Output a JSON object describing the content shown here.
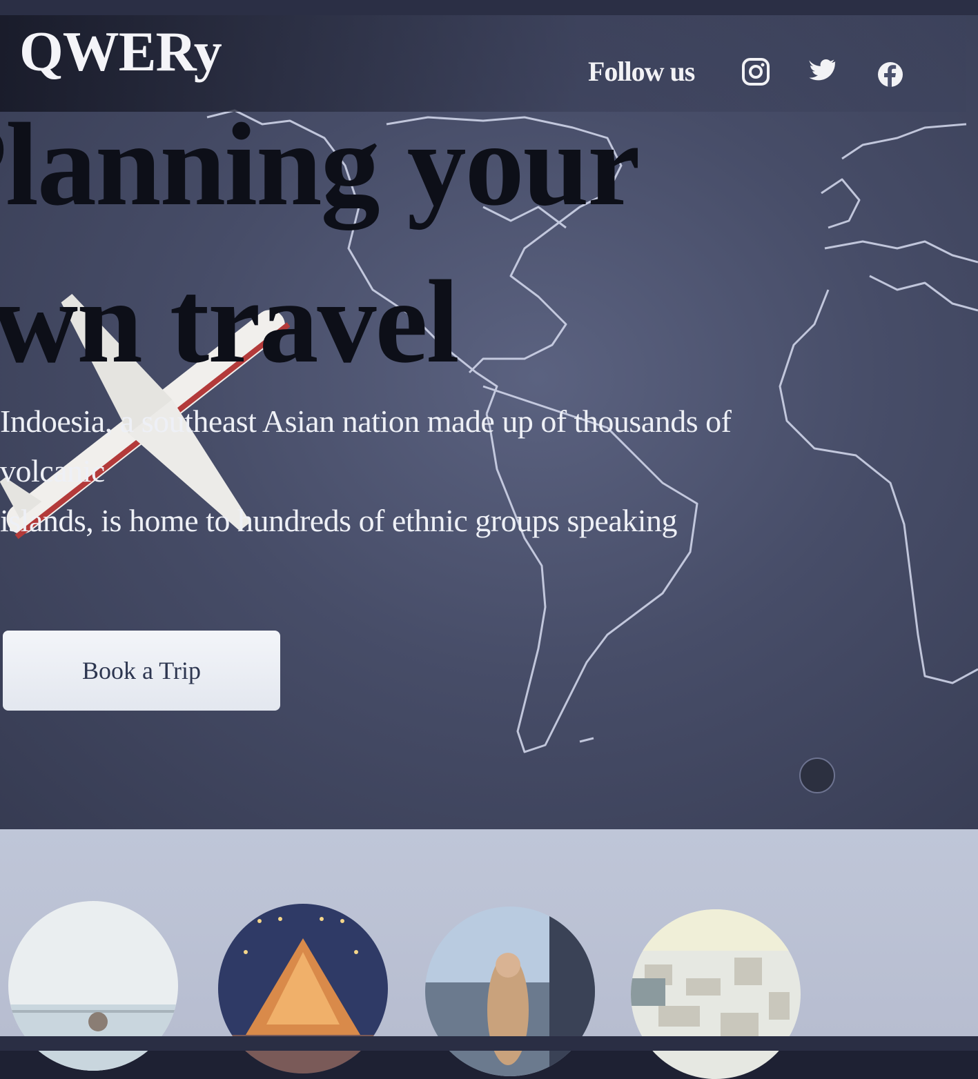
{
  "header": {
    "logo": "QWERy",
    "follow_label": "Follow us",
    "social_icons": [
      "instagram-icon",
      "twitter-icon",
      "facebook-icon"
    ]
  },
  "hero": {
    "headline_line1": "Planning your",
    "headline_line2": "own travel",
    "description_line1": "Indoesia, a southeast Asian nation made up of thousands of",
    "description_line2": "volcanic",
    "description_line3": "islands, is home to hundreds of ethnic groups speaking",
    "cta_label": "Book a Trip"
  },
  "gallery": {
    "thumbnails": [
      "lake-photo",
      "festival-lights-photo",
      "ferry-deck-photo",
      "aerial-city-photo"
    ]
  },
  "colors": {
    "hero_bg": "#474d68",
    "headline": "#0d0f18",
    "button_bg": "#eef1f6",
    "button_text": "#2d3650",
    "gallery_bg": "#bfc6d8"
  }
}
